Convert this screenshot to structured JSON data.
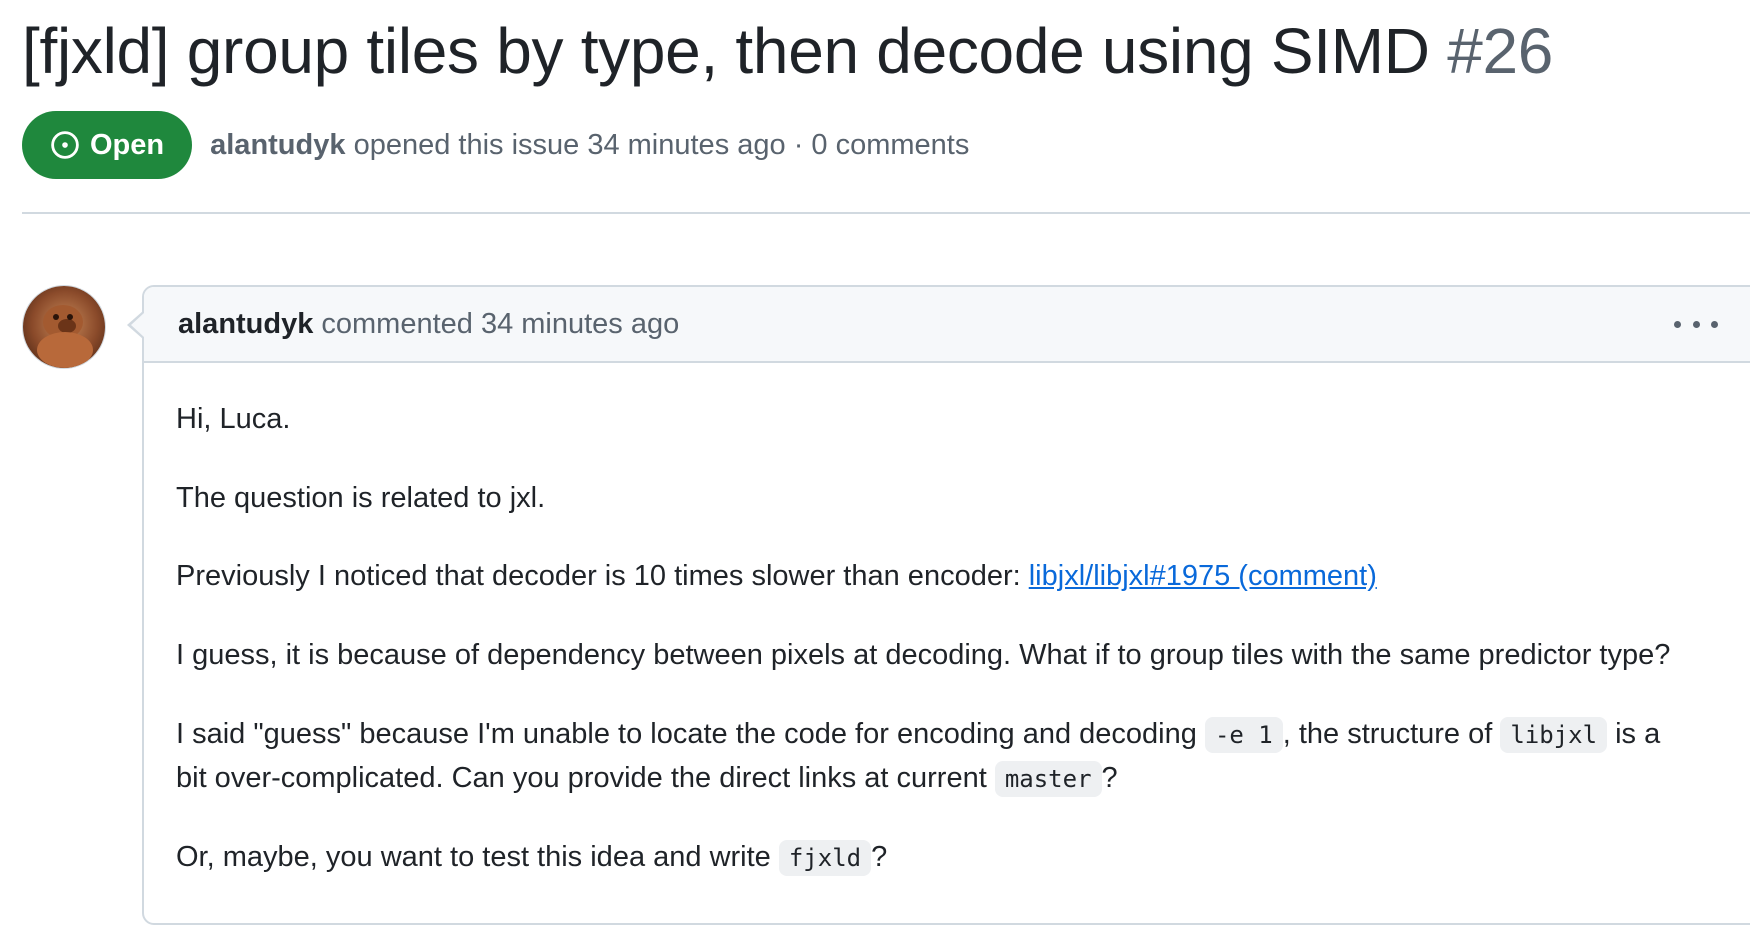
{
  "issue": {
    "title": "[fjxld] group tiles by type, then decode using SIMD",
    "number": "#26",
    "state": "Open",
    "author": "alantudyk",
    "opened_text": "opened this issue 34 minutes ago · 0 comments"
  },
  "comment": {
    "author": "alantudyk",
    "action": "commented 34 minutes ago",
    "paragraphs": {
      "p1": "Hi, Luca.",
      "p2": "The question is related to jxl.",
      "p3_text": "Previously I noticed that decoder is 10 times slower than encoder: ",
      "p3_link": "libjxl/libjxl#1975 (comment)",
      "p4": "I guess, it is because of dependency between pixels at decoding. What if to group tiles with the same predictor type?",
      "p5_a": "I said \"guess\" because I'm unable to locate the code for encoding and decoding ",
      "p5_code1": "-e 1",
      "p5_b": ", the structure of ",
      "p5_code2": "libjxl",
      "p5_c": " is a",
      "p5_d": "bit over-complicated. Can you provide the direct links at current ",
      "p5_code3": "master",
      "p5_e": "?",
      "p6_a": "Or, maybe, you want to test this idea and write ",
      "p6_code": "fjxld",
      "p6_b": "?"
    }
  },
  "colors": {
    "open_badge": "#1f883d",
    "link": "#0969da",
    "muted": "#59636e"
  },
  "icons": {
    "state": "issue-opened-icon",
    "menu": "kebab-horizontal-icon"
  }
}
